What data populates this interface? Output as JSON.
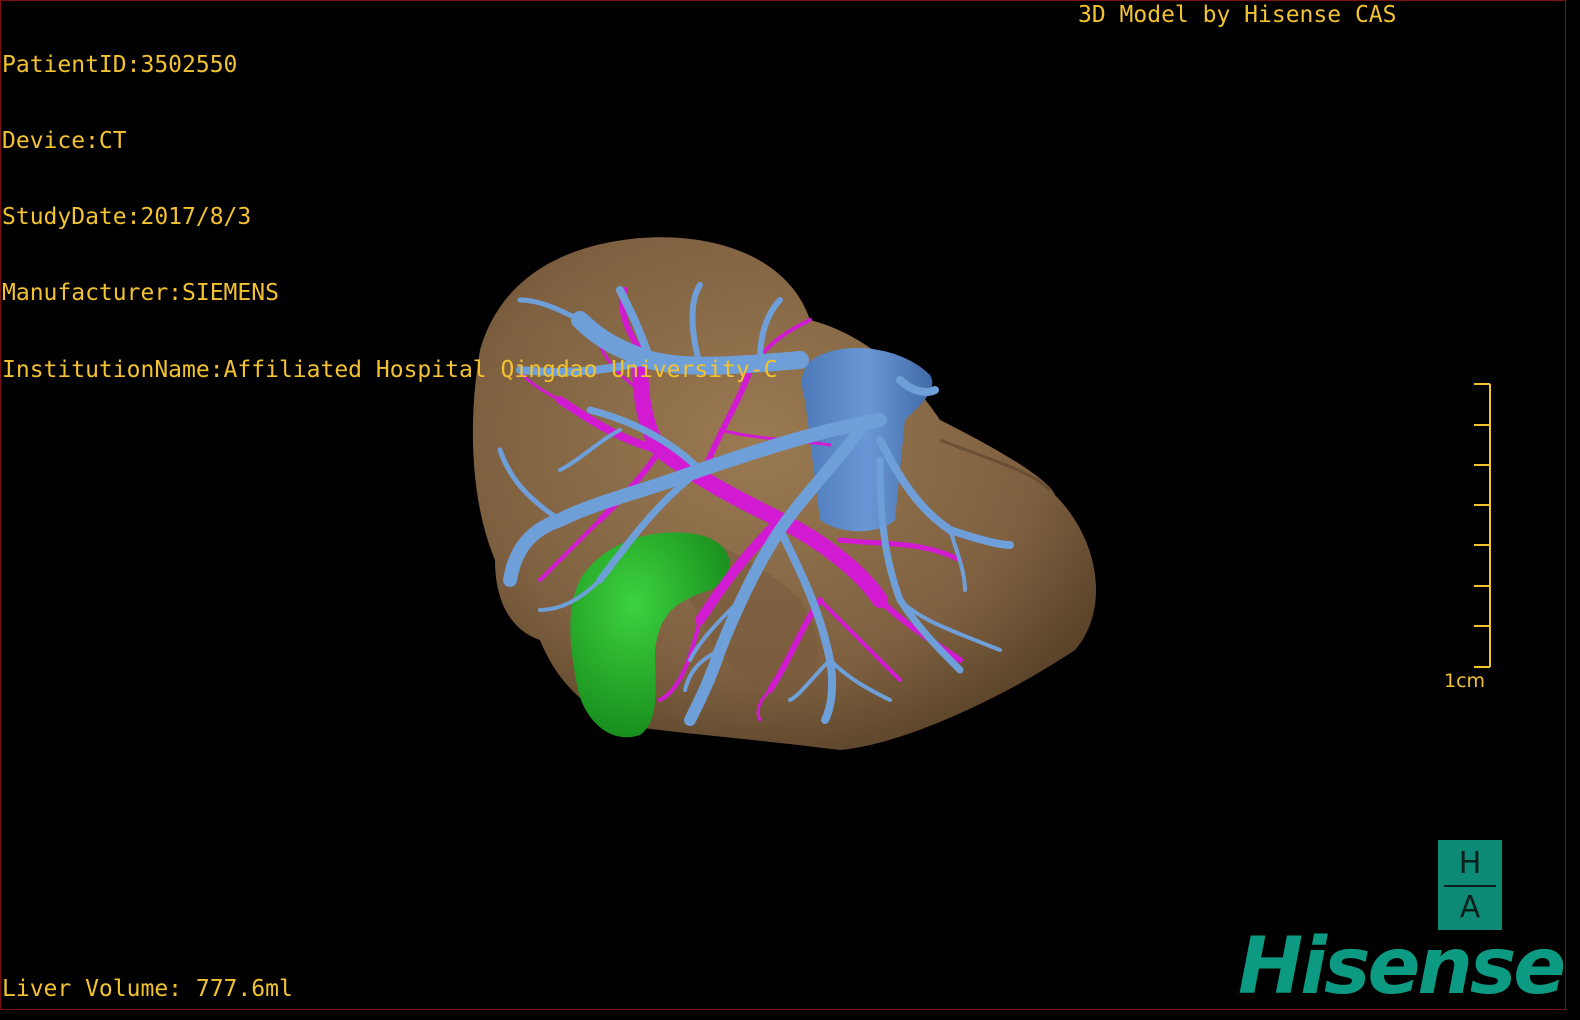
{
  "header": {
    "patient_id": "PatientID:3502550",
    "device": "Device:CT",
    "study_date": "StudyDate:2017/8/3",
    "manufacturer": "Manufacturer:SIEMENS",
    "institution": "InstitutionName:Affiliated Hospital Qingdao University-C"
  },
  "brand_text": "3D Model by Hisense CAS",
  "footer": {
    "liver_volume": "Liver Volume: 777.6ml"
  },
  "scale_bar": {
    "label": "1cm"
  },
  "logo": {
    "badge_top": "H",
    "badge_bottom": "A",
    "wordmark": "Hisense"
  },
  "colors": {
    "text": "#f2c230",
    "liver": "#8a6a45",
    "hepatic_vein": "#6f9fd8",
    "portal_vein": "#d020d0",
    "gallbladder": "#22a82a",
    "logo": "#0c9a82"
  },
  "model": {
    "structures": [
      "liver",
      "hepatic-veins",
      "portal-veins",
      "gallbladder"
    ]
  }
}
